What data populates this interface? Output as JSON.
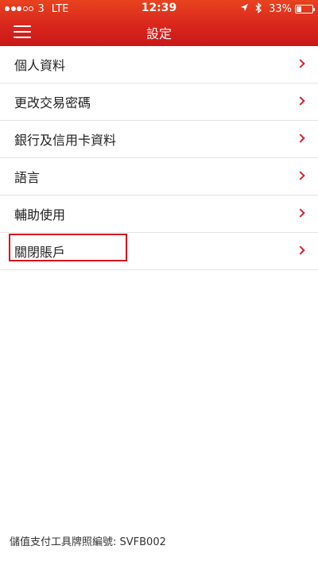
{
  "statusbar": {
    "carrier": "3",
    "network": "LTE",
    "time": "12:39",
    "location_glyph": "location-arrow-icon",
    "bluetooth_glyph": "bluetooth-icon",
    "battery_percent": "33%",
    "battery_level": 0.33,
    "signal_bars_filled": 3,
    "signal_bars_total": 5
  },
  "header": {
    "title": "設定",
    "menu_icon": "hamburger-menu-icon",
    "background_color": "#d9261d"
  },
  "settings": {
    "items": [
      {
        "label": "個人資料"
      },
      {
        "label": "更改交易密碼"
      },
      {
        "label": "銀行及信用卡資料"
      },
      {
        "label": "語言"
      },
      {
        "label": "輔助使用"
      },
      {
        "label": "關閉賬戶"
      }
    ],
    "chevron_color": "#d3242b",
    "highlight_color": "#d9141f"
  },
  "footer": {
    "license_text": "儲值支付工具牌照編號: SVFB002"
  }
}
